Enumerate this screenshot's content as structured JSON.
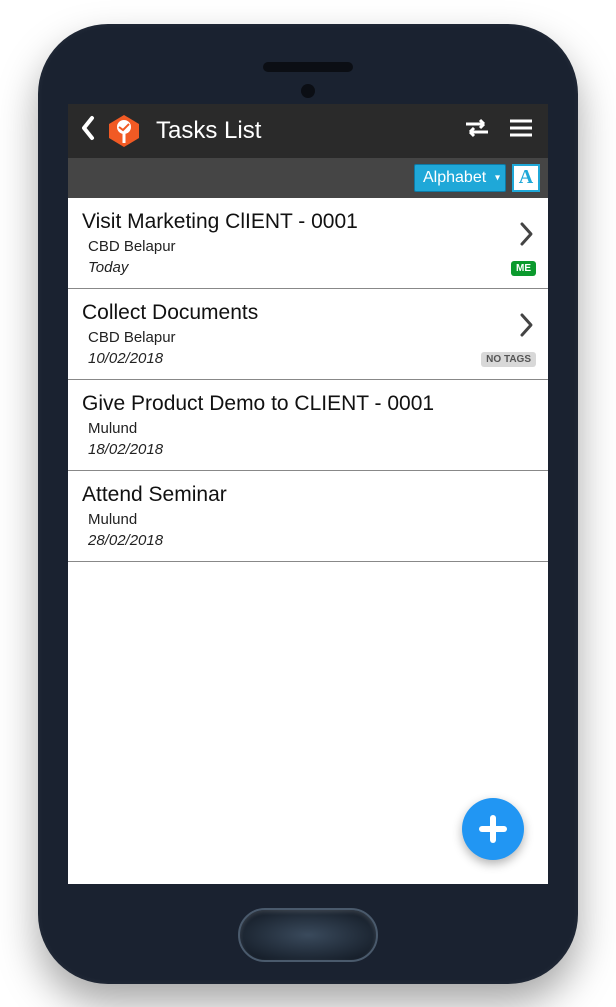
{
  "header": {
    "title": "Tasks List"
  },
  "subheader": {
    "sort_value": "Alphabet",
    "filter_glyph": "A"
  },
  "tasks": [
    {
      "title": "Visit Marketing ClIENT - 0001",
      "location": "CBD Belapur",
      "date": "Today",
      "chevron": true,
      "tag": "ME",
      "tag_class": "tag-me"
    },
    {
      "title": "Collect Documents",
      "location": "CBD Belapur",
      "date": "10/02/2018",
      "chevron": true,
      "tag": "NO TAGS",
      "tag_class": "tag-no"
    },
    {
      "title": "Give Product Demo to CLIENT - 0001",
      "location": "Mulund",
      "date": "18/02/2018",
      "chevron": false,
      "tag": null,
      "tag_class": ""
    },
    {
      "title": "Attend Seminar",
      "location": "Mulund",
      "date": "28/02/2018",
      "chevron": false,
      "tag": null,
      "tag_class": ""
    }
  ]
}
